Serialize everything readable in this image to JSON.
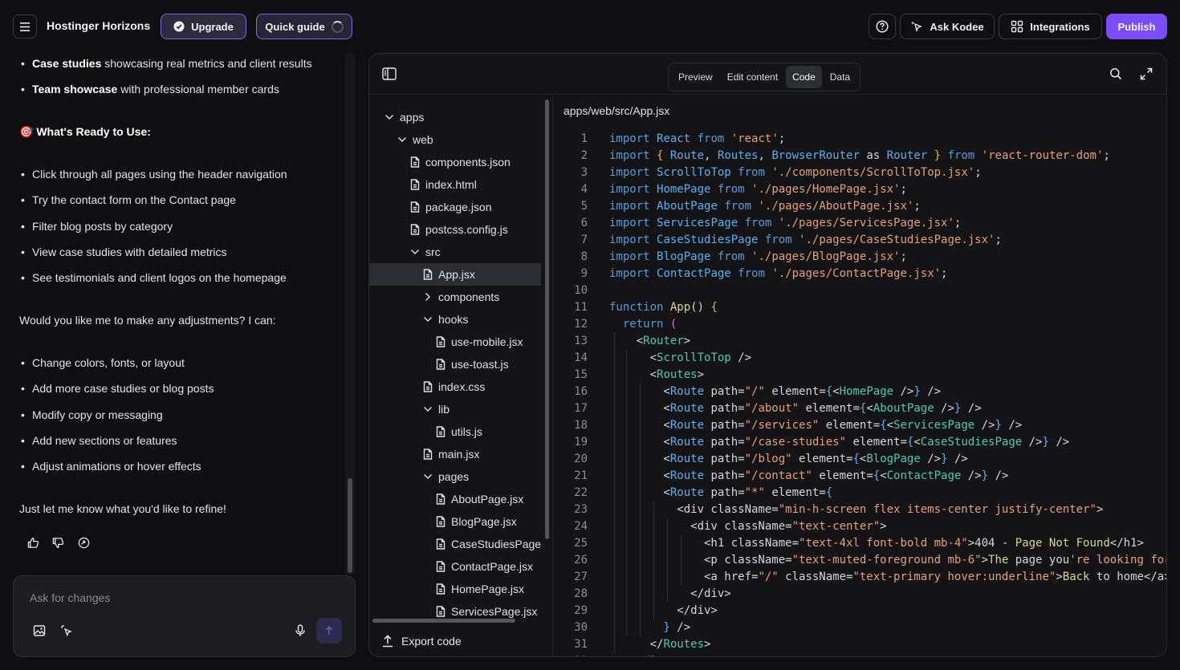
{
  "header": {
    "app_title": "Hostinger Horizons",
    "upgrade_label": "Upgrade",
    "quick_guide_label": "Quick guide",
    "ask_kodee_label": "Ask Kodee",
    "integrations_label": "Integrations",
    "publish_label": "Publish"
  },
  "chat": {
    "top_bullets": [
      {
        "bold": "Case studies",
        "rest": " showcasing real metrics and client results"
      },
      {
        "bold": "Team showcase",
        "rest": " with professional member cards"
      }
    ],
    "ready_heading": "🎯 What's Ready to Use:",
    "ready_bullets": [
      "Click through all pages using the header navigation",
      "Try the contact form on the Contact page",
      "Filter blog posts by category",
      "View case studies with detailed metrics",
      "See testimonials and client logos on the homepage"
    ],
    "adjust_question": "Would you like me to make any adjustments? I can:",
    "adjust_bullets": [
      "Change colors, fonts, or layout",
      "Add more case studies or blog posts",
      "Modify copy or messaging",
      "Add new sections or features",
      "Adjust animations or hover effects"
    ],
    "closing": "Just let me know what you'd like to refine!",
    "composer_placeholder": "Ask for changes"
  },
  "panel": {
    "tabs": [
      "Preview",
      "Edit content",
      "Code",
      "Data"
    ],
    "active_tab": "Code",
    "file_path": "apps/web/src/App.jsx",
    "export_label": "Export code",
    "tree": [
      {
        "label": "apps",
        "type": "folder-open",
        "depth": 0
      },
      {
        "label": "web",
        "type": "folder-open",
        "depth": 1
      },
      {
        "label": "components.json",
        "type": "file",
        "depth": 2
      },
      {
        "label": "index.html",
        "type": "file",
        "depth": 2
      },
      {
        "label": "package.json",
        "type": "file",
        "depth": 2
      },
      {
        "label": "postcss.config.js",
        "type": "file",
        "depth": 2
      },
      {
        "label": "src",
        "type": "folder-open",
        "depth": 2
      },
      {
        "label": "App.jsx",
        "type": "file",
        "depth": 3,
        "selected": true
      },
      {
        "label": "components",
        "type": "folder-closed",
        "depth": 3
      },
      {
        "label": "hooks",
        "type": "folder-open",
        "depth": 3
      },
      {
        "label": "use-mobile.jsx",
        "type": "file",
        "depth": 4
      },
      {
        "label": "use-toast.js",
        "type": "file",
        "depth": 4
      },
      {
        "label": "index.css",
        "type": "file",
        "depth": 3
      },
      {
        "label": "lib",
        "type": "folder-open",
        "depth": 3
      },
      {
        "label": "utils.js",
        "type": "file",
        "depth": 4
      },
      {
        "label": "main.jsx",
        "type": "file",
        "depth": 3
      },
      {
        "label": "pages",
        "type": "folder-open",
        "depth": 3
      },
      {
        "label": "AboutPage.jsx",
        "type": "file",
        "depth": 4
      },
      {
        "label": "BlogPage.jsx",
        "type": "file",
        "depth": 4
      },
      {
        "label": "CaseStudiesPage",
        "type": "file",
        "depth": 4
      },
      {
        "label": "ContactPage.jsx",
        "type": "file",
        "depth": 4
      },
      {
        "label": "HomePage.jsx",
        "type": "file",
        "depth": 4
      },
      {
        "label": "ServicesPage.jsx",
        "type": "file",
        "depth": 4
      }
    ],
    "code_lines": [
      [
        [
          "kw",
          "import "
        ],
        [
          "cmp",
          "React "
        ],
        [
          "kw",
          "from "
        ],
        [
          "str",
          "'react'"
        ],
        [
          "t",
          ";"
        ]
      ],
      [
        [
          "kw",
          "import "
        ],
        [
          "brk",
          "{ "
        ],
        [
          "cmp",
          "Route"
        ],
        [
          "t",
          ", "
        ],
        [
          "cmp",
          "Routes"
        ],
        [
          "t",
          ", "
        ],
        [
          "cmp",
          "BrowserRouter "
        ],
        [
          "t",
          "as "
        ],
        [
          "cmp",
          "Router "
        ],
        [
          "brk",
          "} "
        ],
        [
          "kw",
          "from "
        ],
        [
          "str",
          "'react-router-dom'"
        ],
        [
          "t",
          ";"
        ]
      ],
      [
        [
          "kw",
          "import "
        ],
        [
          "cmp",
          "ScrollToTop "
        ],
        [
          "kw",
          "from "
        ],
        [
          "str",
          "'./components/ScrollToTop.jsx'"
        ],
        [
          "t",
          ";"
        ]
      ],
      [
        [
          "kw",
          "import "
        ],
        [
          "cmp",
          "HomePage "
        ],
        [
          "kw",
          "from "
        ],
        [
          "str",
          "'./pages/HomePage.jsx'"
        ],
        [
          "t",
          ";"
        ]
      ],
      [
        [
          "kw",
          "import "
        ],
        [
          "cmp",
          "AboutPage "
        ],
        [
          "kw",
          "from "
        ],
        [
          "str",
          "'./pages/AboutPage.jsx'"
        ],
        [
          "t",
          ";"
        ]
      ],
      [
        [
          "kw",
          "import "
        ],
        [
          "cmp",
          "ServicesPage "
        ],
        [
          "kw",
          "from "
        ],
        [
          "str",
          "'./pages/ServicesPage.jsx'"
        ],
        [
          "t",
          ";"
        ]
      ],
      [
        [
          "kw",
          "import "
        ],
        [
          "cmp",
          "CaseStudiesPage "
        ],
        [
          "kw",
          "from "
        ],
        [
          "str",
          "'./pages/CaseStudiesPage.jsx'"
        ],
        [
          "t",
          ";"
        ]
      ],
      [
        [
          "kw",
          "import "
        ],
        [
          "cmp",
          "BlogPage "
        ],
        [
          "kw",
          "from "
        ],
        [
          "str",
          "'./pages/BlogPage.jsx'"
        ],
        [
          "t",
          ";"
        ]
      ],
      [
        [
          "kw",
          "import "
        ],
        [
          "cmp",
          "ContactPage "
        ],
        [
          "kw",
          "from "
        ],
        [
          "str",
          "'./pages/ContactPage.jsx'"
        ],
        [
          "t",
          ";"
        ]
      ],
      [],
      [
        [
          "kw",
          "function "
        ],
        [
          "fn",
          "App"
        ],
        [
          "t",
          "() "
        ],
        [
          "brk",
          "{"
        ]
      ],
      [
        [
          "t",
          "  "
        ],
        [
          "kw",
          "return "
        ],
        [
          "brk2",
          "("
        ]
      ],
      [
        [
          "t",
          "    <"
        ],
        [
          "jsx",
          "Router"
        ],
        [
          "t",
          ">"
        ]
      ],
      [
        [
          "t",
          "      <"
        ],
        [
          "jsx",
          "ScrollToTop"
        ],
        [
          "t",
          " />"
        ]
      ],
      [
        [
          "t",
          "      <"
        ],
        [
          "jsx",
          "Routes"
        ],
        [
          "t",
          ">"
        ]
      ],
      [
        [
          "t",
          "        <"
        ],
        [
          "cmp",
          "Route "
        ],
        [
          "t",
          "path="
        ],
        [
          "str",
          "\"/\" "
        ],
        [
          "t",
          "element="
        ],
        [
          "cmp",
          "{"
        ],
        [
          "t",
          "<"
        ],
        [
          "jsx",
          "HomePage"
        ],
        [
          "t",
          " />"
        ],
        [
          "cmp",
          "}"
        ],
        [
          "t",
          " />"
        ]
      ],
      [
        [
          "t",
          "        <"
        ],
        [
          "cmp",
          "Route "
        ],
        [
          "t",
          "path="
        ],
        [
          "str",
          "\"/about\" "
        ],
        [
          "t",
          "element="
        ],
        [
          "cmp",
          "{"
        ],
        [
          "t",
          "<"
        ],
        [
          "jsx",
          "AboutPage"
        ],
        [
          "t",
          " />"
        ],
        [
          "cmp",
          "}"
        ],
        [
          "t",
          " />"
        ]
      ],
      [
        [
          "t",
          "        <"
        ],
        [
          "cmp",
          "Route "
        ],
        [
          "t",
          "path="
        ],
        [
          "str",
          "\"/services\" "
        ],
        [
          "t",
          "element="
        ],
        [
          "cmp",
          "{"
        ],
        [
          "t",
          "<"
        ],
        [
          "jsx",
          "ServicesPage"
        ],
        [
          "t",
          " />"
        ],
        [
          "cmp",
          "}"
        ],
        [
          "t",
          " />"
        ]
      ],
      [
        [
          "t",
          "        <"
        ],
        [
          "cmp",
          "Route "
        ],
        [
          "t",
          "path="
        ],
        [
          "str",
          "\"/case-studies\" "
        ],
        [
          "t",
          "element="
        ],
        [
          "cmp",
          "{"
        ],
        [
          "t",
          "<"
        ],
        [
          "jsx",
          "CaseStudiesPage"
        ],
        [
          "t",
          " />"
        ],
        [
          "cmp",
          "}"
        ],
        [
          "t",
          " />"
        ]
      ],
      [
        [
          "t",
          "        <"
        ],
        [
          "cmp",
          "Route "
        ],
        [
          "t",
          "path="
        ],
        [
          "str",
          "\"/blog\" "
        ],
        [
          "t",
          "element="
        ],
        [
          "cmp",
          "{"
        ],
        [
          "t",
          "<"
        ],
        [
          "jsx",
          "BlogPage"
        ],
        [
          "t",
          " />"
        ],
        [
          "cmp",
          "}"
        ],
        [
          "t",
          " />"
        ]
      ],
      [
        [
          "t",
          "        <"
        ],
        [
          "cmp",
          "Route "
        ],
        [
          "t",
          "path="
        ],
        [
          "str",
          "\"/contact\" "
        ],
        [
          "t",
          "element="
        ],
        [
          "cmp",
          "{"
        ],
        [
          "t",
          "<"
        ],
        [
          "jsx",
          "ContactPage"
        ],
        [
          "t",
          " />"
        ],
        [
          "cmp",
          "}"
        ],
        [
          "t",
          " />"
        ]
      ],
      [
        [
          "t",
          "        <"
        ],
        [
          "cmp",
          "Route "
        ],
        [
          "t",
          "path="
        ],
        [
          "str",
          "\"*\" "
        ],
        [
          "t",
          "element="
        ],
        [
          "cmp",
          "{"
        ]
      ],
      [
        [
          "t",
          "          <div className="
        ],
        [
          "str",
          "\"min-h-screen flex items-center justify-center\""
        ],
        [
          "t",
          ">"
        ]
      ],
      [
        [
          "t",
          "            <div className="
        ],
        [
          "str",
          "\"text-center\""
        ],
        [
          "t",
          ">"
        ]
      ],
      [
        [
          "t",
          "              <h1 className="
        ],
        [
          "str",
          "\"text-4xl font-bold mb-4\""
        ],
        [
          "t",
          ">404 - "
        ],
        [
          "fn",
          "Page Not Found"
        ],
        [
          "t",
          "</h1>"
        ]
      ],
      [
        [
          "t",
          "              <p className="
        ],
        [
          "str",
          "\"text-muted-foreground mb-6\""
        ],
        [
          "t",
          ">"
        ],
        [
          "fn",
          "The "
        ],
        [
          "t",
          "page you"
        ],
        [
          "str",
          "'re looking for"
        ]
      ],
      [
        [
          "t",
          "              <a href="
        ],
        [
          "str",
          "\"/\" "
        ],
        [
          "t",
          "className="
        ],
        [
          "str",
          "\"text-primary hover:underline\""
        ],
        [
          "t",
          ">"
        ],
        [
          "fn",
          "Back "
        ],
        [
          "t",
          "to home</a>"
        ]
      ],
      [
        [
          "t",
          "            </div>"
        ]
      ],
      [
        [
          "t",
          "          </div>"
        ]
      ],
      [
        [
          "t",
          "        "
        ],
        [
          "cmp",
          "}"
        ],
        [
          "t",
          " />"
        ]
      ],
      [
        [
          "t",
          "      </"
        ],
        [
          "jsx",
          "Routes"
        ],
        [
          "t",
          ">"
        ]
      ],
      [
        [
          "t",
          "    </"
        ],
        [
          "jsx",
          "Router"
        ],
        [
          "t",
          ">"
        ]
      ]
    ]
  },
  "colors": {
    "accent": "#7c4dff",
    "background": "#0f0f11",
    "panel": "#141417"
  },
  "icons": [
    "menu-icon",
    "upgrade-badge-icon",
    "loading-spinner-icon",
    "help-icon",
    "sparkle-cursor-icon",
    "integrations-grid-icon",
    "sidebar-toggle-icon",
    "search-icon",
    "expand-icon",
    "thumbs-up-icon",
    "thumbs-down-icon",
    "refresh-icon",
    "image-icon",
    "pointer-select-icon",
    "microphone-icon",
    "arrow-up-icon",
    "export-icon",
    "file-icon",
    "chevron-down-icon",
    "chevron-right-icon"
  ]
}
